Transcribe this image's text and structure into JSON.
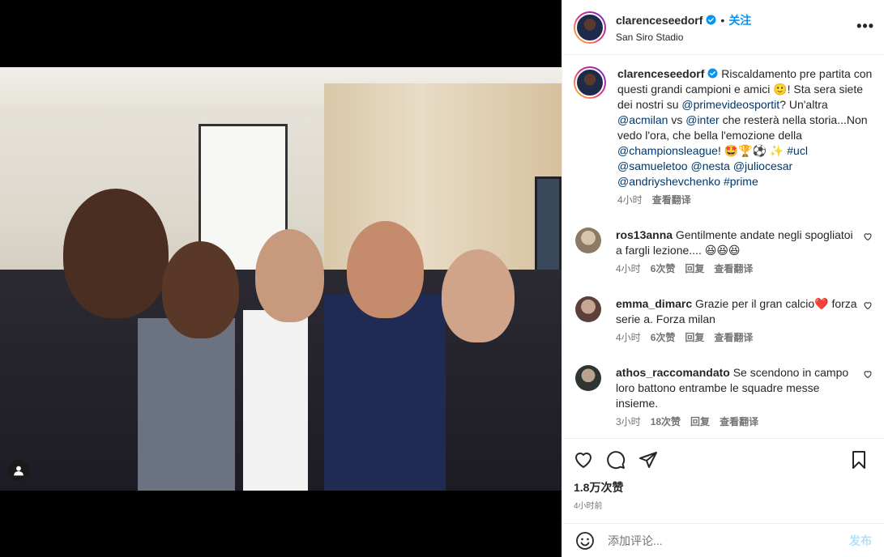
{
  "post": {
    "username": "clarenceseedorf",
    "follow_label": "关注",
    "location": "San Siro Stadio",
    "more_label": "•••"
  },
  "caption": {
    "username": "clarenceseedorf",
    "text_1": " Riscaldamento pre partita con questi grandi campioni e amici 🙂! Sta sera siete dei nostri su ",
    "mention_1": "@primevideosportit",
    "text_2": "? Un'altra ",
    "mention_2": "@acmilan",
    "text_3": " vs ",
    "mention_3": "@inter",
    "text_4": " che resterà nella storia...Non vedo l'ora, che bella l'emozione della ",
    "mention_4": "@championsleague",
    "text_5": "! 🤩🏆⚽ ✨ ",
    "hashtag_1": "#ucl",
    "mention_5": "@samueletoo",
    "mention_6": "@nesta",
    "mention_7": "@juliocesar",
    "mention_8": "@andriyshevchenko",
    "hashtag_2": "#prime",
    "time": "4小时",
    "translate": "查看翻译"
  },
  "comments": [
    {
      "username": "ros13anna",
      "text": " Gentilmente andate negli spogliatoi a fargli lezione.... 😆😆😆",
      "time": "4小时",
      "likes": "6次赞",
      "reply": "回复",
      "translate": "查看翻译",
      "avatar_color": "#b9a48c"
    },
    {
      "username": "emma_dimarc",
      "text": " Grazie per il gran calcio❤️ forza serie a. Forza milan",
      "time": "4小时",
      "likes": "6次赞",
      "reply": "回复",
      "translate": "查看翻译",
      "avatar_color": "#8a6a5a"
    },
    {
      "username": "athos_raccomandato",
      "text": " Se scendono in campo loro battono entrambe le squadre messe insieme.",
      "time": "3小时",
      "likes": "18次赞",
      "reply": "回复",
      "translate": "查看翻译",
      "avatar_color": "#6e7a74"
    }
  ],
  "footer": {
    "likes": "1.8万次赞",
    "time_ago": "4小时前"
  },
  "add_comment": {
    "placeholder": "添加评论...",
    "post_label": "发布"
  },
  "colors": {
    "accent": "#0095f6",
    "mention": "#00376b",
    "muted": "#737373"
  }
}
